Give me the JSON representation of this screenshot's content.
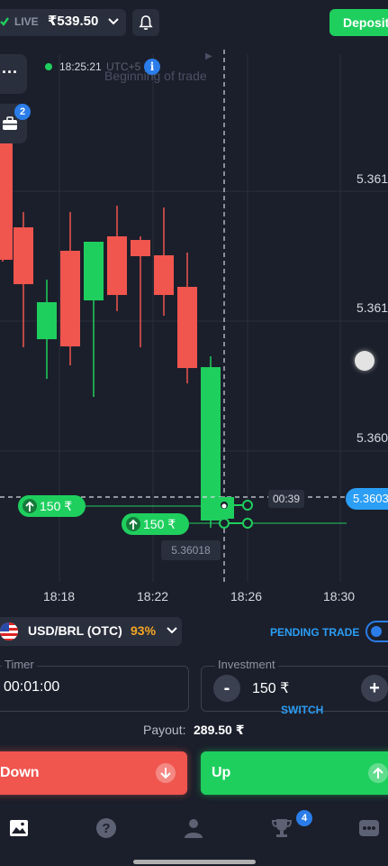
{
  "header": {
    "account_label": "LIVE",
    "balance": "₹539.50",
    "deposit_label": "Deposit"
  },
  "chart": {
    "server_time": "18:25:21",
    "timezone": "UTC+5",
    "beginning_label": "Beginning of trade",
    "badge_count": "2",
    "price_ticks": [
      "5.361",
      "5.361",
      "5.360"
    ],
    "time_ticks": [
      "18:18",
      "18:22",
      "18:26",
      "18:30"
    ],
    "current_price": "5.3603",
    "countdown": "00:39",
    "entry_price": "5.36018",
    "trades": [
      {
        "amount": "150 ₹"
      },
      {
        "amount": "150 ₹"
      }
    ],
    "colors": {
      "up": "#1fcf5e",
      "down": "#f0554e",
      "accent": "#2b9ef5"
    }
  },
  "chart_data": {
    "type": "candlestick",
    "x_ticks": [
      "18:18",
      "18:22",
      "18:26",
      "18:30"
    ],
    "y_ticks": [
      "5.361",
      "5.361",
      "5.360"
    ],
    "current_price": "5.3603",
    "entry_price": "5.36018",
    "candles": [
      {
        "dir": "down"
      },
      {
        "dir": "down"
      },
      {
        "dir": "up"
      },
      {
        "dir": "down"
      },
      {
        "dir": "up"
      },
      {
        "dir": "down"
      },
      {
        "dir": "down"
      },
      {
        "dir": "down"
      },
      {
        "dir": "down"
      },
      {
        "dir": "up"
      }
    ]
  },
  "asset": {
    "name": "USD/BRL (OTC)",
    "payout_pct": "93%",
    "pending_label": "PENDING TRADE"
  },
  "timer": {
    "label": "Timer",
    "value": "00:01:00"
  },
  "investment": {
    "label": "Investment",
    "value": "150 ₹",
    "switch_label": "SWITCH",
    "minus": "-",
    "plus": "+"
  },
  "payout": {
    "label": "Payout:",
    "value": "289.50 ₹"
  },
  "actions": {
    "down_label": "Down",
    "up_label": "Up"
  },
  "nav": {
    "badge_count": "4"
  }
}
